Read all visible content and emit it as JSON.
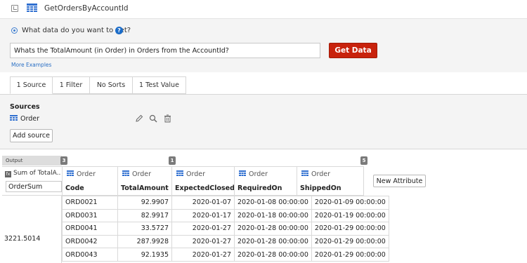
{
  "header": {
    "title": "GetOrdersByAccountId"
  },
  "query": {
    "question_label": "What data do you want to get?",
    "help_symbol": "?",
    "input_value": "Whats the TotalAmount (in Order) in Orders from the AccountId?",
    "get_data_label": "Get Data",
    "more_examples_label": "More Examples"
  },
  "tabs": [
    {
      "label": "1 Source"
    },
    {
      "label": "1 Filter"
    },
    {
      "label": "No Sorts"
    },
    {
      "label": "1 Test Value"
    }
  ],
  "sources": {
    "heading": "Sources",
    "items": [
      {
        "name": "Order"
      }
    ],
    "add_label": "Add source"
  },
  "output": {
    "tag_label": "Output",
    "badges": [
      "3",
      "1",
      "5"
    ],
    "aggregate": {
      "label": "Sum of TotalA...",
      "name_value": "OrderSum",
      "value": "3221.5014"
    },
    "columns": [
      {
        "entity": "Order",
        "field": "Code"
      },
      {
        "entity": "Order",
        "field": "TotalAmount"
      },
      {
        "entity": "Order",
        "field": "ExpectedClosedOn"
      },
      {
        "entity": "Order",
        "field": "RequiredOn"
      },
      {
        "entity": "Order",
        "field": "ShippedOn"
      }
    ],
    "new_attribute_label": "New Attribute",
    "rows": [
      [
        "ORD0021",
        "92.9907",
        "2020-01-07",
        "2020-01-08 00:00:00",
        "2020-01-09 00:00:00"
      ],
      [
        "ORD0031",
        "82.9917",
        "2020-01-17",
        "2020-01-18 00:00:00",
        "2020-01-19 00:00:00"
      ],
      [
        "ORD0041",
        "33.5727",
        "2020-01-27",
        "2020-01-28 00:00:00",
        "2020-01-29 00:00:00"
      ],
      [
        "ORD0042",
        "287.9928",
        "2020-01-27",
        "2020-01-28 00:00:00",
        "2020-01-29 00:00:00"
      ],
      [
        "ORD0043",
        "92.1935",
        "2020-01-27",
        "2020-01-28 00:00:00",
        "2020-01-29 00:00:00"
      ]
    ]
  },
  "colors": {
    "accent_blue": "#1b6cc8",
    "get_data_red": "#c8230d",
    "panel_gray": "#f4f4f4"
  }
}
